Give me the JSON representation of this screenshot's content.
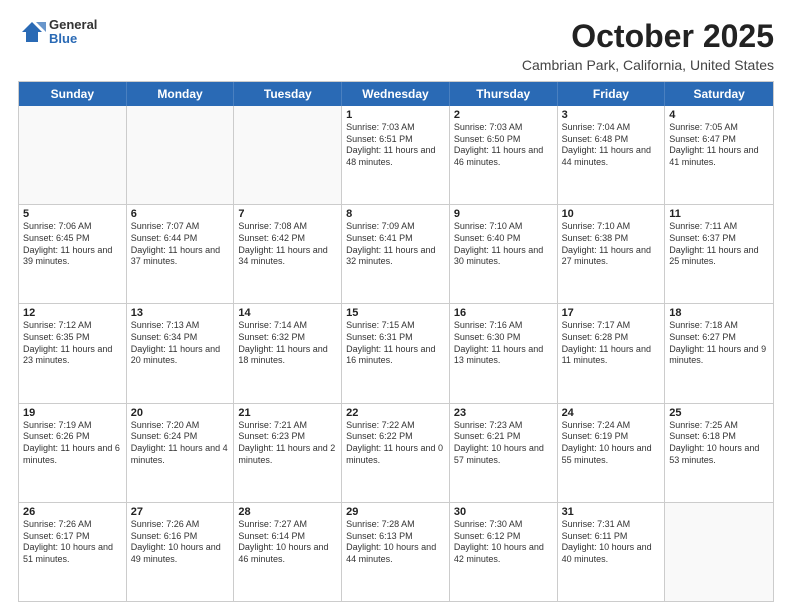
{
  "header": {
    "logo": {
      "general": "General",
      "blue": "Blue"
    },
    "title": "October 2025",
    "subtitle": "Cambrian Park, California, United States"
  },
  "calendar": {
    "weekdays": [
      "Sunday",
      "Monday",
      "Tuesday",
      "Wednesday",
      "Thursday",
      "Friday",
      "Saturday"
    ],
    "rows": [
      [
        {
          "day": "",
          "info": ""
        },
        {
          "day": "",
          "info": ""
        },
        {
          "day": "",
          "info": ""
        },
        {
          "day": "1",
          "info": "Sunrise: 7:03 AM\nSunset: 6:51 PM\nDaylight: 11 hours and 48 minutes."
        },
        {
          "day": "2",
          "info": "Sunrise: 7:03 AM\nSunset: 6:50 PM\nDaylight: 11 hours and 46 minutes."
        },
        {
          "day": "3",
          "info": "Sunrise: 7:04 AM\nSunset: 6:48 PM\nDaylight: 11 hours and 44 minutes."
        },
        {
          "day": "4",
          "info": "Sunrise: 7:05 AM\nSunset: 6:47 PM\nDaylight: 11 hours and 41 minutes."
        }
      ],
      [
        {
          "day": "5",
          "info": "Sunrise: 7:06 AM\nSunset: 6:45 PM\nDaylight: 11 hours and 39 minutes."
        },
        {
          "day": "6",
          "info": "Sunrise: 7:07 AM\nSunset: 6:44 PM\nDaylight: 11 hours and 37 minutes."
        },
        {
          "day": "7",
          "info": "Sunrise: 7:08 AM\nSunset: 6:42 PM\nDaylight: 11 hours and 34 minutes."
        },
        {
          "day": "8",
          "info": "Sunrise: 7:09 AM\nSunset: 6:41 PM\nDaylight: 11 hours and 32 minutes."
        },
        {
          "day": "9",
          "info": "Sunrise: 7:10 AM\nSunset: 6:40 PM\nDaylight: 11 hours and 30 minutes."
        },
        {
          "day": "10",
          "info": "Sunrise: 7:10 AM\nSunset: 6:38 PM\nDaylight: 11 hours and 27 minutes."
        },
        {
          "day": "11",
          "info": "Sunrise: 7:11 AM\nSunset: 6:37 PM\nDaylight: 11 hours and 25 minutes."
        }
      ],
      [
        {
          "day": "12",
          "info": "Sunrise: 7:12 AM\nSunset: 6:35 PM\nDaylight: 11 hours and 23 minutes."
        },
        {
          "day": "13",
          "info": "Sunrise: 7:13 AM\nSunset: 6:34 PM\nDaylight: 11 hours and 20 minutes."
        },
        {
          "day": "14",
          "info": "Sunrise: 7:14 AM\nSunset: 6:32 PM\nDaylight: 11 hours and 18 minutes."
        },
        {
          "day": "15",
          "info": "Sunrise: 7:15 AM\nSunset: 6:31 PM\nDaylight: 11 hours and 16 minutes."
        },
        {
          "day": "16",
          "info": "Sunrise: 7:16 AM\nSunset: 6:30 PM\nDaylight: 11 hours and 13 minutes."
        },
        {
          "day": "17",
          "info": "Sunrise: 7:17 AM\nSunset: 6:28 PM\nDaylight: 11 hours and 11 minutes."
        },
        {
          "day": "18",
          "info": "Sunrise: 7:18 AM\nSunset: 6:27 PM\nDaylight: 11 hours and 9 minutes."
        }
      ],
      [
        {
          "day": "19",
          "info": "Sunrise: 7:19 AM\nSunset: 6:26 PM\nDaylight: 11 hours and 6 minutes."
        },
        {
          "day": "20",
          "info": "Sunrise: 7:20 AM\nSunset: 6:24 PM\nDaylight: 11 hours and 4 minutes."
        },
        {
          "day": "21",
          "info": "Sunrise: 7:21 AM\nSunset: 6:23 PM\nDaylight: 11 hours and 2 minutes."
        },
        {
          "day": "22",
          "info": "Sunrise: 7:22 AM\nSunset: 6:22 PM\nDaylight: 11 hours and 0 minutes."
        },
        {
          "day": "23",
          "info": "Sunrise: 7:23 AM\nSunset: 6:21 PM\nDaylight: 10 hours and 57 minutes."
        },
        {
          "day": "24",
          "info": "Sunrise: 7:24 AM\nSunset: 6:19 PM\nDaylight: 10 hours and 55 minutes."
        },
        {
          "day": "25",
          "info": "Sunrise: 7:25 AM\nSunset: 6:18 PM\nDaylight: 10 hours and 53 minutes."
        }
      ],
      [
        {
          "day": "26",
          "info": "Sunrise: 7:26 AM\nSunset: 6:17 PM\nDaylight: 10 hours and 51 minutes."
        },
        {
          "day": "27",
          "info": "Sunrise: 7:26 AM\nSunset: 6:16 PM\nDaylight: 10 hours and 49 minutes."
        },
        {
          "day": "28",
          "info": "Sunrise: 7:27 AM\nSunset: 6:14 PM\nDaylight: 10 hours and 46 minutes."
        },
        {
          "day": "29",
          "info": "Sunrise: 7:28 AM\nSunset: 6:13 PM\nDaylight: 10 hours and 44 minutes."
        },
        {
          "day": "30",
          "info": "Sunrise: 7:30 AM\nSunset: 6:12 PM\nDaylight: 10 hours and 42 minutes."
        },
        {
          "day": "31",
          "info": "Sunrise: 7:31 AM\nSunset: 6:11 PM\nDaylight: 10 hours and 40 minutes."
        },
        {
          "day": "",
          "info": ""
        }
      ]
    ]
  }
}
